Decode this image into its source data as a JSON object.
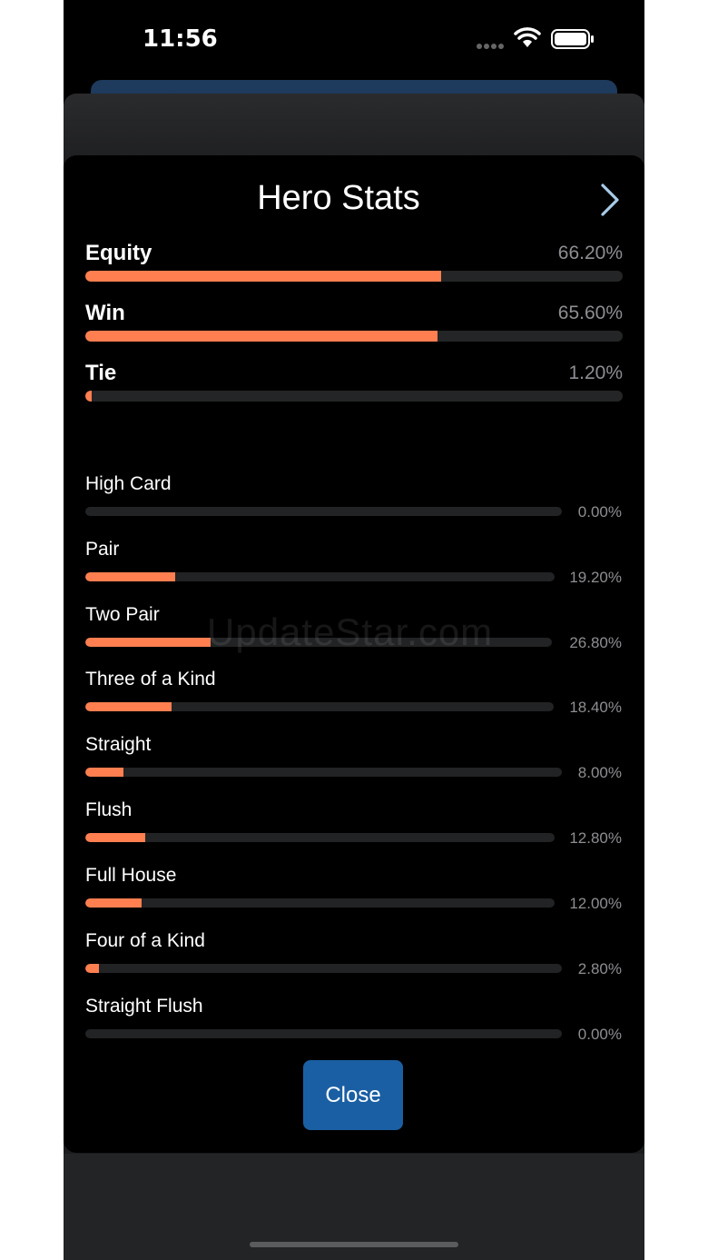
{
  "status_bar": {
    "time": "11:56"
  },
  "modal": {
    "title": "Hero Stats",
    "close_label": "Close"
  },
  "main_stats": [
    {
      "label": "Equity",
      "value": "66.20%",
      "percent": 66.2
    },
    {
      "label": "Win",
      "value": "65.60%",
      "percent": 65.6
    },
    {
      "label": "Tie",
      "value": "1.20%",
      "percent": 1.2
    }
  ],
  "hand_stats": [
    {
      "label": "High Card",
      "value": "0.00%",
      "percent": 0.0
    },
    {
      "label": "Pair",
      "value": "19.20%",
      "percent": 19.2
    },
    {
      "label": "Two Pair",
      "value": "26.80%",
      "percent": 26.8
    },
    {
      "label": "Three of a Kind",
      "value": "18.40%",
      "percent": 18.4
    },
    {
      "label": "Straight",
      "value": "8.00%",
      "percent": 8.0
    },
    {
      "label": "Flush",
      "value": "12.80%",
      "percent": 12.8
    },
    {
      "label": "Full House",
      "value": "12.00%",
      "percent": 12.0
    },
    {
      "label": "Four of a Kind",
      "value": "2.80%",
      "percent": 2.8
    },
    {
      "label": "Straight Flush",
      "value": "0.00%",
      "percent": 0.0
    }
  ],
  "watermark": "UpdateStar.com",
  "colors": {
    "bar_fill": "#ff7f50",
    "button": "#1a5fa3",
    "track": "#242526"
  },
  "icons": [
    "signal-icon",
    "wifi-icon",
    "battery-icon",
    "chevron-right-icon"
  ]
}
